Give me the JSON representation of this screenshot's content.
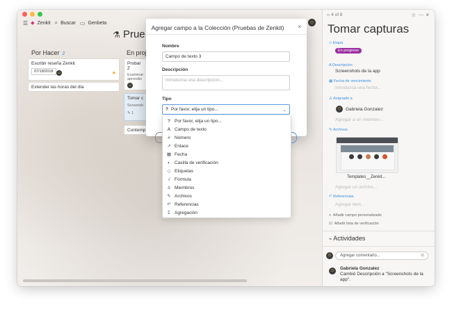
{
  "window": {
    "dot_colors": [
      "#fc605c",
      "#fdbc40",
      "#34c84a"
    ],
    "nav": {
      "app": "Zenkit",
      "search": "Buscar",
      "org": "Genbeta"
    }
  },
  "board": {
    "title": "Prue",
    "columns": [
      {
        "title": "Por Hacer",
        "count": "2"
      },
      {
        "title": "En proj"
      }
    ],
    "cards": {
      "c1": {
        "title": "Escribir reseña Zenkit",
        "date": "07/18/2018"
      },
      "c2": {
        "title": "Extender las horas del día"
      },
      "c3": {
        "title": "Probar Z",
        "sub1": "Examinar",
        "sub2": "aprendiz"
      },
      "c4": {
        "title": "Tomar c",
        "sub": "Screensh",
        "count": "1"
      },
      "c5": {
        "title": "Contemp"
      }
    }
  },
  "modal": {
    "title": "Agregar campo a la Colección (Pruebas de Zenkit)",
    "name_label": "Nombre",
    "name_value": "Campo de texto 3",
    "desc_label": "Descripción",
    "desc_placeholder": "Introduzca una descripción...",
    "type_label": "Tipo",
    "type_value": "Por favor, elija un tipo...",
    "type_options": [
      {
        "icon": "?",
        "label": "Por favor, elija un tipo..."
      },
      {
        "icon": "A",
        "label": "Campo de texto"
      },
      {
        "icon": "#",
        "label": "Número"
      },
      {
        "icon": "↗",
        "label": "Enlace"
      },
      {
        "icon": "▦",
        "label": "Fecha"
      },
      {
        "icon": "◐",
        "label": "Casilla de verificación"
      },
      {
        "icon": "◇",
        "label": "Etiquetas"
      },
      {
        "icon": "√",
        "label": "Fórmula"
      },
      {
        "icon": "♙",
        "label": "Miembros"
      },
      {
        "icon": "✎",
        "label": "Archivos"
      },
      {
        "icon": "↶",
        "label": "Referencias"
      },
      {
        "icon": "Σ",
        "label": "Agregación"
      }
    ]
  },
  "panel": {
    "counter": "4 of 8",
    "title": "Tomar capturas",
    "stage_label": "Etapa",
    "stage_value": "En progreso",
    "stage_color": "#9b2fa0",
    "desc_label": "Descripción",
    "desc_value": "Screenshots de la app",
    "due_label": "Fecha de vencimiento",
    "due_hint": "Introduzca una fecha...",
    "assigned_label": "Asignado a",
    "assigned_value": "Gabriela Gonzalez",
    "assigned_hint": "Agregar a un miembro...",
    "files_label": "Archivos",
    "file_name": "Templates__Zenkit...",
    "files_hint": "Agregar un archivo...",
    "refs_label": "Referencias",
    "refs_hint": "Agregar item...",
    "add_field": "Añadir campo personalizado",
    "add_checklist": "Añadir lista de verificación",
    "activity_title": "Actividades",
    "comment_placeholder": "Agregar comentario...",
    "activity_user": "Gabriela Gonzalez",
    "activity_text": "Cambió Descripción a \"Screenshots de la app\"."
  },
  "accent_color": "#3d8ede"
}
